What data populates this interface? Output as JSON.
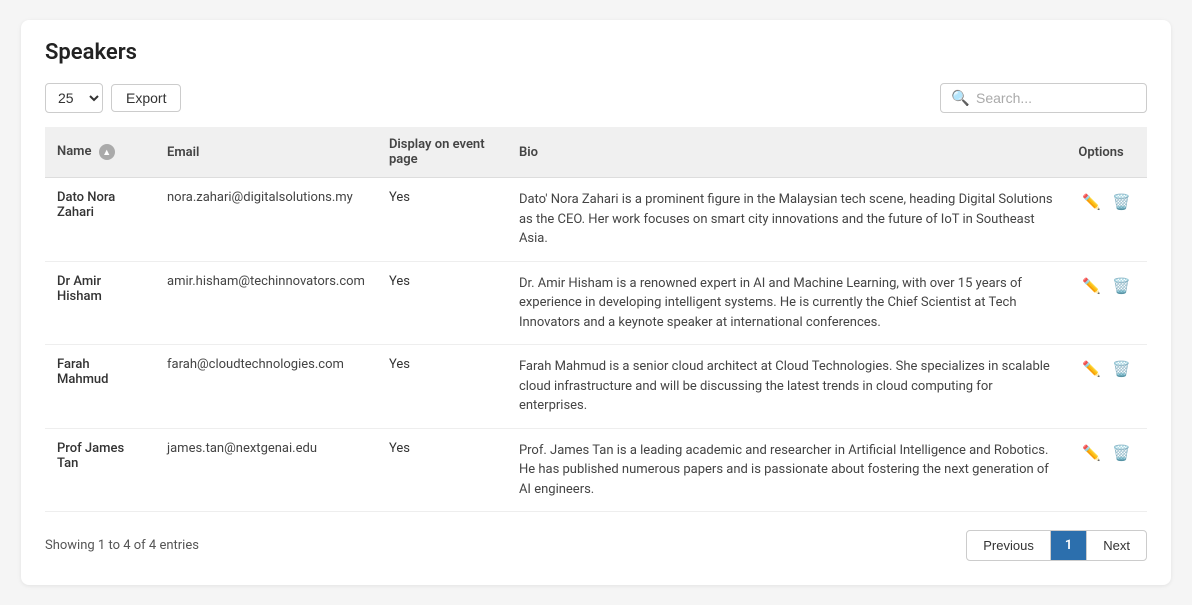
{
  "page": {
    "title": "Speakers"
  },
  "toolbar": {
    "per_page_value": "25",
    "export_label": "Export",
    "search_placeholder": "Search..."
  },
  "table": {
    "columns": [
      "Name",
      "Email",
      "Display on event page",
      "Bio",
      "Options"
    ],
    "rows": [
      {
        "name": "Dato Nora Zahari",
        "email": "nora.zahari@digitalsolutions.my",
        "display": "Yes",
        "bio": "Dato' Nora Zahari is a prominent figure in the Malaysian tech scene, heading Digital Solutions as the CEO. Her work focuses on smart city innovations and the future of IoT in Southeast Asia."
      },
      {
        "name": "Dr Amir Hisham",
        "email": "amir.hisham@techinnovators.com",
        "display": "Yes",
        "bio": "Dr. Amir Hisham is a renowned expert in AI and Machine Learning, with over 15 years of experience in developing intelligent systems. He is currently the Chief Scientist at Tech Innovators and a keynote speaker at international conferences."
      },
      {
        "name": "Farah Mahmud",
        "email": "farah@cloudtechnologies.com",
        "display": "Yes",
        "bio": "Farah Mahmud is a senior cloud architect at Cloud Technologies. She specializes in scalable cloud infrastructure and will be discussing the latest trends in cloud computing for enterprises."
      },
      {
        "name": "Prof James Tan",
        "email": "james.tan@nextgenai.edu",
        "display": "Yes",
        "bio": "Prof. James Tan is a leading academic and researcher in Artificial Intelligence and Robotics. He has published numerous papers and is passionate about fostering the next generation of AI engineers."
      }
    ]
  },
  "footer": {
    "showing_text": "Showing 1 to 4 of 4 entries",
    "previous_label": "Previous",
    "current_page": "1",
    "next_label": "Next"
  }
}
